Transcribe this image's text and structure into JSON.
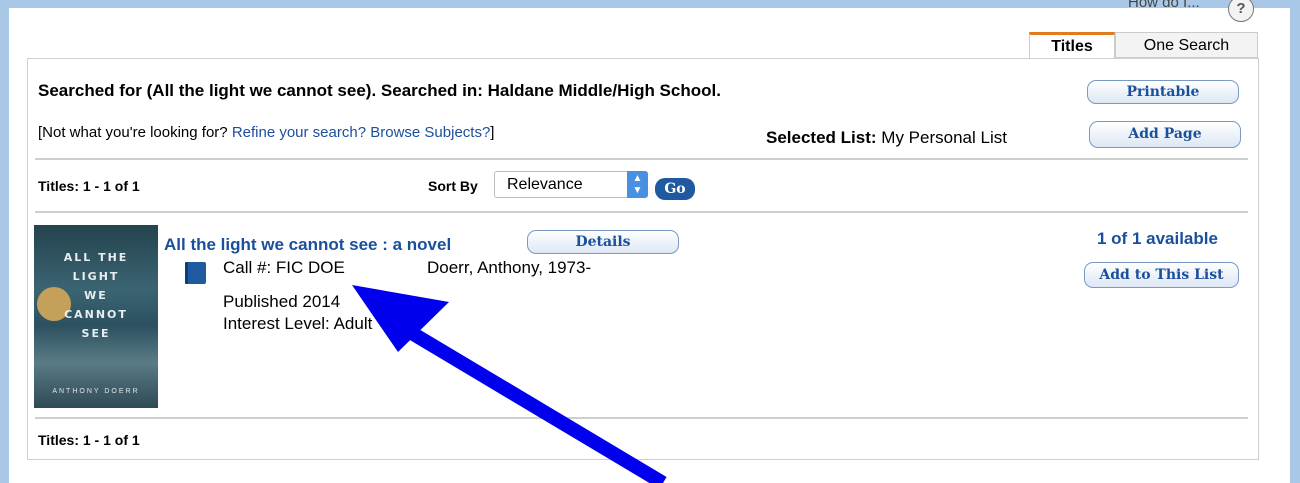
{
  "header": {
    "help_text": "How do I...",
    "help_icon_glyph": "?"
  },
  "tabs": [
    {
      "label": "Titles",
      "active": true
    },
    {
      "label": "One Search",
      "active": false
    }
  ],
  "search": {
    "summary": "Searched for (All the light we cannot see). Searched in: Haldane Middle/High School.",
    "refine_prefix": "[Not what you're looking for? ",
    "refine_link": "Refine your search?",
    "browse_link": "Browse Subjects?",
    "refine_suffix": "]",
    "selected_list_label": "Selected List:",
    "selected_list_value": "My Personal List"
  },
  "buttons": {
    "printable": "Printable",
    "add_page": "Add Page",
    "details": "Details",
    "add_to_list": "Add to This List",
    "go": "Go"
  },
  "results": {
    "count_top": "Titles: 1 - 1 of 1",
    "count_bottom": "Titles: 1 - 1 of 1",
    "sort_label": "Sort By",
    "sort_value": "Relevance",
    "item": {
      "title": "All the light we cannot see : a novel",
      "call_number": "Call #: FIC DOE",
      "author": "Doerr, Anthony, 1973-",
      "published": "Published 2014",
      "interest_level": "Interest Level: Adult",
      "availability": "1 of 1 available",
      "cover_text": "ALL THE\nLIGHT\nWE\nCANNOT\nSEE",
      "cover_author": "ANTHONY DOERR"
    }
  },
  "colors": {
    "frame": "#a9c8e8",
    "link": "#1a4f9c",
    "tab_accent": "#e07b1f",
    "annotation_arrow": "#0000ee"
  }
}
